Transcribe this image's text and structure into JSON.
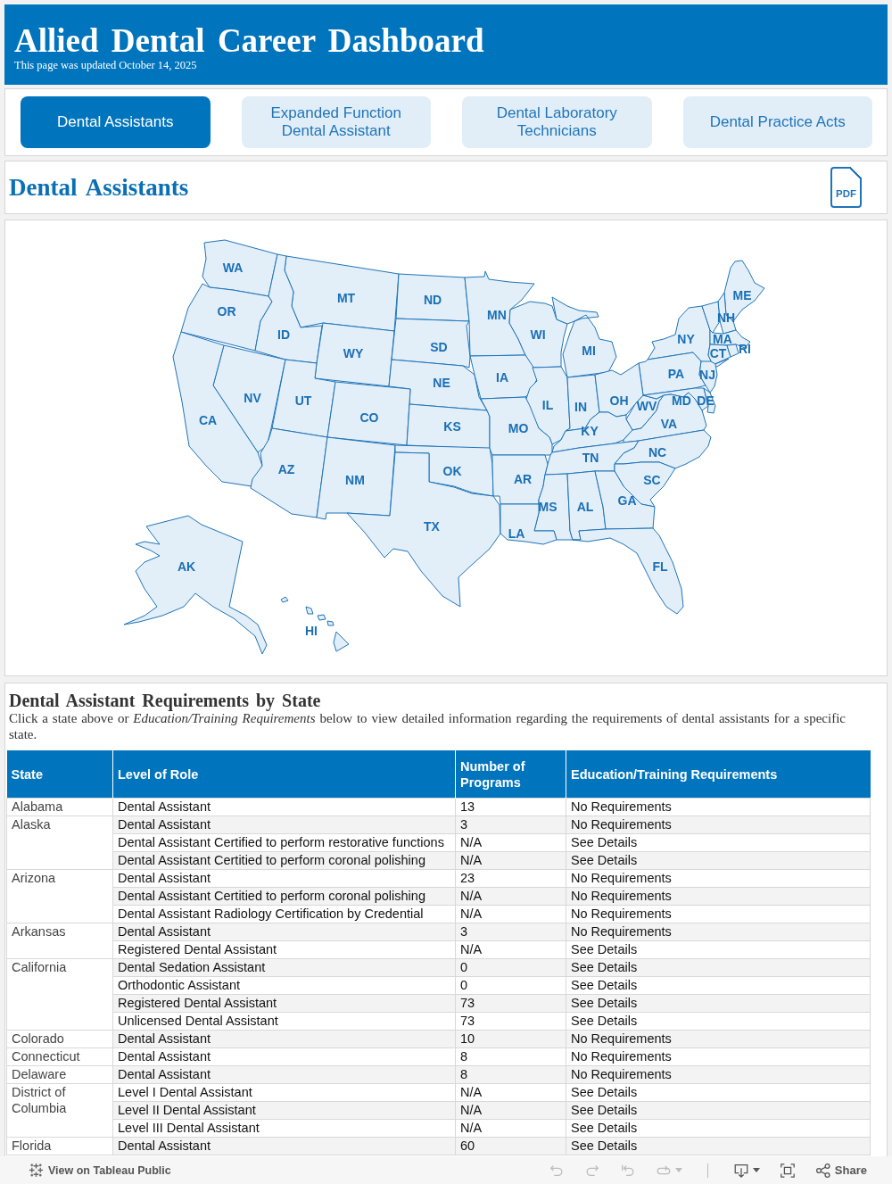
{
  "header": {
    "title": "Allied Dental Career Dashboard",
    "updated": "This page was updated October 14, 2025"
  },
  "tabs": [
    {
      "label": "Dental Assistants",
      "selected": true
    },
    {
      "label": "Expanded Function Dental Assistant",
      "selected": false
    },
    {
      "label": "Dental Laboratory Technicians",
      "selected": false
    },
    {
      "label": "Dental Practice Acts",
      "selected": false
    }
  ],
  "section": {
    "title": "Dental Assistants",
    "pdf_label": "PDF"
  },
  "map": {
    "states": [
      {
        "label": "WA"
      },
      {
        "label": "MT"
      },
      {
        "label": "ND"
      },
      {
        "label": "ME"
      },
      {
        "label": "OR"
      },
      {
        "label": "MN"
      },
      {
        "label": "NH"
      },
      {
        "label": "ID"
      },
      {
        "label": "WI"
      },
      {
        "label": "NY"
      },
      {
        "label": "MA"
      },
      {
        "label": "WY"
      },
      {
        "label": "SD"
      },
      {
        "label": "MI"
      },
      {
        "label": "CT"
      },
      {
        "label": "RI"
      },
      {
        "label": "NE"
      },
      {
        "label": "IA"
      },
      {
        "label": "PA"
      },
      {
        "label": "NJ"
      },
      {
        "label": "NV"
      },
      {
        "label": "UT"
      },
      {
        "label": "IL"
      },
      {
        "label": "IN"
      },
      {
        "label": "OH"
      },
      {
        "label": "WV"
      },
      {
        "label": "MD"
      },
      {
        "label": "DE"
      },
      {
        "label": "CA"
      },
      {
        "label": "CO"
      },
      {
        "label": "KS"
      },
      {
        "label": "MO"
      },
      {
        "label": "KY"
      },
      {
        "label": "VA"
      },
      {
        "label": "TN"
      },
      {
        "label": "NC"
      },
      {
        "label": "AZ"
      },
      {
        "label": "NM"
      },
      {
        "label": "OK"
      },
      {
        "label": "AR"
      },
      {
        "label": "SC"
      },
      {
        "label": "MS"
      },
      {
        "label": "AL"
      },
      {
        "label": "GA"
      },
      {
        "label": "TX"
      },
      {
        "label": "LA"
      },
      {
        "label": "AK"
      },
      {
        "label": "FL"
      },
      {
        "label": "HI"
      }
    ]
  },
  "requirements": {
    "title": "Dental Assistant Requirements by State",
    "description": "Click a state above or *Education/Training Requirements* below to view detailed information regarding the requirements of dental assistants for a specific state.",
    "columns": [
      "State",
      "Level of Role",
      "Number of Programs",
      "Education/Training Requirements"
    ],
    "groups": [
      {
        "state": "Alabama",
        "rows": [
          {
            "level": "Dental Assistant",
            "programs": "13",
            "requirements": "No Requirements"
          }
        ]
      },
      {
        "state": "Alaska",
        "rows": [
          {
            "level": "Dental Assistant",
            "programs": "3",
            "requirements": "No Requirements"
          },
          {
            "level": "Dental Assistant Certified to perform restorative functions",
            "programs": "N/A",
            "requirements": "See Details"
          },
          {
            "level": "Dental Assistant Certitied to perform coronal polishing",
            "programs": "N/A",
            "requirements": "See Details"
          }
        ]
      },
      {
        "state": "Arizona",
        "rows": [
          {
            "level": "Dental Assistant",
            "programs": "23",
            "requirements": "No Requirements"
          },
          {
            "level": "Dental Assistant Certitied to perform coronal polishing",
            "programs": "N/A",
            "requirements": "No Requirements"
          },
          {
            "level": "Dental Assistant Radiology Certification by Credential",
            "programs": "N/A",
            "requirements": "No Requirements"
          }
        ]
      },
      {
        "state": "Arkansas",
        "rows": [
          {
            "level": "Dental Assistant",
            "programs": "3",
            "requirements": "No Requirements"
          },
          {
            "level": "Registered Dental Assistant",
            "programs": "N/A",
            "requirements": "See Details"
          }
        ]
      },
      {
        "state": "California",
        "rows": [
          {
            "level": "Dental Sedation Assistant",
            "programs": "0",
            "requirements": "See Details"
          },
          {
            "level": "Orthodontic Assistant",
            "programs": "0",
            "requirements": "See Details"
          },
          {
            "level": "Registered Dental Assistant",
            "programs": "73",
            "requirements": "See Details"
          },
          {
            "level": "Unlicensed Dental Assistant",
            "programs": "73",
            "requirements": "See Details"
          }
        ]
      },
      {
        "state": "Colorado",
        "rows": [
          {
            "level": "Dental Assistant",
            "programs": "10",
            "requirements": "No Requirements"
          }
        ]
      },
      {
        "state": "Connecticut",
        "rows": [
          {
            "level": "Dental Assistant",
            "programs": "8",
            "requirements": "No Requirements"
          }
        ]
      },
      {
        "state": "Delaware",
        "rows": [
          {
            "level": "Dental Assistant",
            "programs": "8",
            "requirements": "No Requirements"
          }
        ]
      },
      {
        "state": "District of Columbia",
        "rows": [
          {
            "level": "Level I Dental Assistant",
            "programs": "N/A",
            "requirements": "See Details"
          },
          {
            "level": "Level II Dental Assistant",
            "programs": "N/A",
            "requirements": "See Details"
          },
          {
            "level": "Level III Dental Assistant",
            "programs": "N/A",
            "requirements": "See Details"
          }
        ]
      },
      {
        "state": "Florida",
        "rows": [
          {
            "level": "Dental Assistant",
            "programs": "60",
            "requirements": "See Details"
          }
        ]
      }
    ]
  },
  "toolbar": {
    "link": "View on Tableau Public",
    "buttons": [
      {
        "kind": "undo",
        "disabled": true,
        "menu": false
      },
      {
        "kind": "redo",
        "disabled": true,
        "menu": false
      },
      {
        "kind": "revert",
        "disabled": true,
        "menu": false
      },
      {
        "kind": "refresh",
        "disabled": true,
        "menu": true
      },
      {
        "kind": "download",
        "disabled": false,
        "menu": true
      },
      {
        "kind": "fullscreen",
        "disabled": false,
        "menu": false
      },
      {
        "kind": "share",
        "label": "Share",
        "disabled": false,
        "menu": false
      }
    ]
  }
}
